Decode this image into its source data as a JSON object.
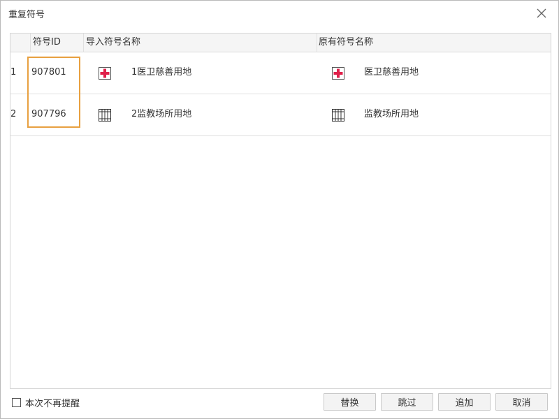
{
  "dialog": {
    "title": "重复符号"
  },
  "table": {
    "headers": {
      "index": "",
      "symbol_id": "符号ID",
      "import_name": "导入符号名称",
      "existing_name": "原有符号名称"
    },
    "rows": [
      {
        "index": "1",
        "symbol_id": "907801",
        "import_icon": "red-cross-icon",
        "import_name": "1医卫慈善用地",
        "existing_icon": "red-cross-icon",
        "existing_name": "医卫慈善用地"
      },
      {
        "index": "2",
        "symbol_id": "907796",
        "import_icon": "grid-bars-icon",
        "import_name": "2监教场所用地",
        "existing_icon": "grid-bars-icon",
        "existing_name": "监教场所用地"
      }
    ]
  },
  "footer": {
    "dont_remind_label": "本次不再提醒",
    "dont_remind_checked": false,
    "buttons": {
      "replace": "替换",
      "skip": "跳过",
      "append": "追加",
      "cancel": "取消"
    }
  },
  "colors": {
    "highlight_border": "#e8a040",
    "red_cross": "#e0204a"
  }
}
